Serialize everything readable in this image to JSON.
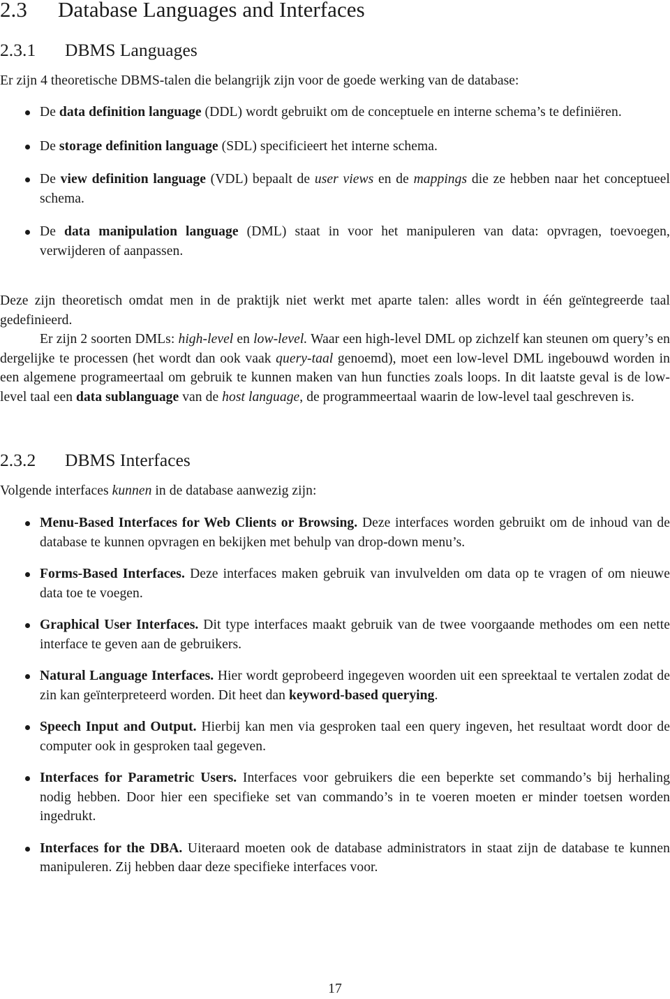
{
  "section": {
    "number": "2.3",
    "title": "Database Languages and Interfaces"
  },
  "subsection1": {
    "number": "2.3.1",
    "title": "DBMS Languages",
    "intro": "Er zijn 4 theoretische DBMS-talen die belangrijk zijn voor de goede werking van de database:",
    "items": [
      {
        "pre": "De ",
        "term": "data definition language",
        "post": " (DDL) wordt gebruikt om de conceptuele en interne schema’s te definiëren."
      },
      {
        "pre": "De ",
        "term": "storage definition language",
        "post": " (SDL) specificieert het interne schema."
      },
      {
        "pre": "De ",
        "term": "view definition language",
        "mid1": " (VDL) bepaalt de ",
        "em1": "user views",
        "mid2": " en de ",
        "em2": "mappings",
        "post": " die ze hebben naar het conceptueel schema."
      },
      {
        "pre": "De ",
        "term": "data manipulation language",
        "post": " (DML) staat in voor het manipuleren van data: opvragen, toevoegen, verwijderen of aanpassen."
      }
    ],
    "paragraph1": "Deze zijn theoretisch omdat men in de praktijk niet werkt met aparte talen: alles wordt in één geïntegreerde taal gedefinieerd.",
    "paragraph2": {
      "t1": "Er zijn 2 soorten DMLs: ",
      "em1": "high-level",
      "t2": " en ",
      "em2": "low-level.",
      "t3": " Waar een high-level DML op zichzelf kan steunen om query’s en dergelijke te processen (het wordt dan ook vaak ",
      "em3": "query-taal",
      "t4": " genoemd), moet een low-level DML ingebouwd worden in een algemene programeertaal om gebruik te kunnen maken van hun functies zoals loops. In dit laatste geval is de low-level taal een ",
      "strong1": "data sublanguage",
      "t5": " van de ",
      "em4": "host language",
      "t6": ", de programmeertaal waarin de low-level taal geschreven is."
    }
  },
  "subsection2": {
    "number": "2.3.2",
    "title": "DBMS Interfaces",
    "intro": {
      "t1": "Volgende interfaces ",
      "em1": "kunnen",
      "t2": " in de database aanwezig zijn:"
    },
    "items": [
      {
        "term": "Menu-Based Interfaces for Web Clients or Browsing.",
        "text": " Deze interfaces worden gebruikt om de inhoud van de database te kunnen opvragen en bekijken met behulp van drop-down menu’s."
      },
      {
        "term": "Forms-Based Interfaces.",
        "text": " Deze interfaces maken gebruik van invulvelden om data op te vragen of om nieuwe data toe te voegen."
      },
      {
        "term": "Graphical User Interfaces.",
        "text": " Dit type interfaces maakt gebruik van de twee voorgaande methodes om een nette interface te geven aan de gebruikers."
      },
      {
        "term": "Natural Language Interfaces.",
        "text": " Hier wordt geprobeerd ingegeven woorden uit een spreektaal te vertalen zodat de zin kan geïnterpreteerd worden. Dit heet dan ",
        "strong": "keyword-based querying",
        "tail": "."
      },
      {
        "term": "Speech Input and Output.",
        "text": " Hierbij kan men via gesproken taal een query ingeven, het resultaat wordt door de computer ook in gesproken taal gegeven."
      },
      {
        "term": "Interfaces for Parametric Users.",
        "text": " Interfaces voor gebruikers die een beperkte set commando’s bij herhaling nodig hebben. Door hier een specifieke set van commando’s in te voeren moeten er minder toetsen worden ingedrukt."
      },
      {
        "term": "Interfaces for the DBA.",
        "text": " Uiteraard moeten ook de database administrators in staat zijn de database te kunnen manipuleren. Zij hebben daar deze specifieke interfaces voor."
      }
    ]
  },
  "footer": {
    "page_number": "17"
  }
}
